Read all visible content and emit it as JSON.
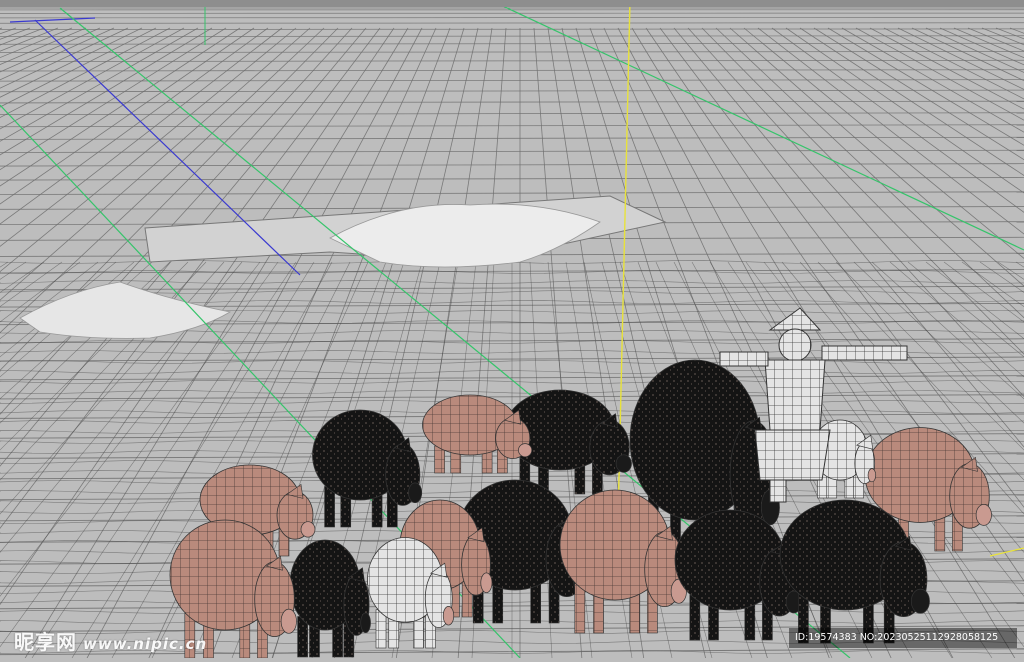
{
  "viewport": {
    "scene": "3d-wireframe-pig-herd",
    "axis_colors": {
      "x": "#35c46a",
      "y": "#e8e23a",
      "z": "#3a3ad0"
    },
    "grid_color": "#6e6e6e",
    "background_color": "#bdbdbd",
    "pig_color": "#b98a7c",
    "dark_pig_color": "#121212"
  },
  "watermark": {
    "brand": "昵享网",
    "url": "www.nipic.cn"
  },
  "image_id": {
    "text": "ID:19574383 NO:20230525112928058125"
  }
}
